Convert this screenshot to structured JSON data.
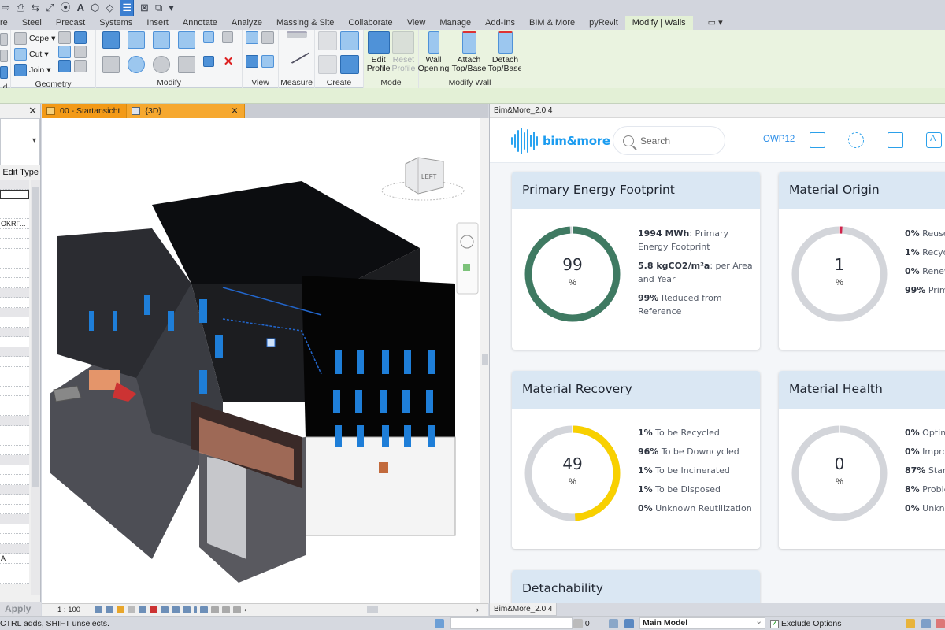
{
  "qat": {
    "items": [
      "arrow-redo",
      "printer",
      "measure",
      "dimension",
      "tag",
      "text",
      "3d-view",
      "section",
      "thin-lines",
      "close-hidden",
      "switch-windows",
      "customize"
    ]
  },
  "ribbon_tabs": [
    {
      "label": "re"
    },
    {
      "label": "Steel"
    },
    {
      "label": "Precast"
    },
    {
      "label": "Systems"
    },
    {
      "label": "Insert"
    },
    {
      "label": "Annotate"
    },
    {
      "label": "Analyze"
    },
    {
      "label": "Massing & Site"
    },
    {
      "label": "Collaborate"
    },
    {
      "label": "View"
    },
    {
      "label": "Manage"
    },
    {
      "label": "Add-Ins"
    },
    {
      "label": "BIM & More"
    },
    {
      "label": "pyRevit"
    },
    {
      "label": "Modify | Walls"
    }
  ],
  "ribbon": {
    "clipboard_title": "d",
    "geometry": {
      "title": "Geometry",
      "cope": "Cope",
      "cut": "Cut",
      "join": "Join"
    },
    "modify": {
      "title": "Modify"
    },
    "view": {
      "title": "View"
    },
    "measure": {
      "title": "Measure"
    },
    "create": {
      "title": "Create"
    },
    "mode": {
      "title": "Mode",
      "edit_profile": "Edit Profile",
      "reset_profile": "Reset Profile"
    },
    "modify_wall": {
      "title": "Modify Wall",
      "wall_opening": "Wall Opening",
      "attach": "Attach Top/Base",
      "detach": "Detach Top/Base"
    }
  },
  "properties": {
    "edit_type": "Edit Type",
    "apply": "Apply",
    "value_1": "OKRF...",
    "value_2": "A"
  },
  "view_tabs": [
    {
      "label": "00 - Startansicht"
    },
    {
      "label": "{3D}"
    }
  ],
  "viewcube": {
    "face": "LEFT"
  },
  "view_bar": {
    "scale": "1 : 100"
  },
  "bim_window": {
    "title": "Bim&More_2.0.4",
    "logo": "bim&more",
    "search_placeholder": "Search",
    "project": "OWP12",
    "colors": {
      "accent": "#1b9cf0",
      "header_bg": "#dae7f3",
      "green": "#3f7a62",
      "yellow": "#f8d000",
      "track": "#d3d5da",
      "red": "#d0234a"
    }
  },
  "cards": [
    {
      "title": "Primary Energy Footprint",
      "value": "99",
      "unit": "%",
      "percent": 99,
      "color": "#3f7a62",
      "legend": [
        {
          "bold": "1994 MWh",
          "text": ": Primary Energy Footprint"
        },
        {
          "bold": "5.8 kgCO2/m²a",
          "text": ": per Area and Year"
        },
        {
          "bold": "99%",
          "text": " Reduced from Reference"
        }
      ]
    },
    {
      "title": "Material Origin",
      "value": "1",
      "unit": "%",
      "percent": 1,
      "color": "#d0234a",
      "legend": [
        {
          "bold": "0%",
          "text": " Reuse"
        },
        {
          "bold": "1%",
          "text": " Recycl"
        },
        {
          "bold": "0%",
          "text": " Renew Materials"
        },
        {
          "bold": "99%",
          "text": " Prim"
        }
      ]
    },
    {
      "title": "Material Recovery",
      "value": "49",
      "unit": "%",
      "percent": 49,
      "color": "#f8d000",
      "legend": [
        {
          "bold": "1%",
          "text": " To be Recycled"
        },
        {
          "bold": "96%",
          "text": " To be Downcycled"
        },
        {
          "bold": "1%",
          "text": " To be Incinerated"
        },
        {
          "bold": "1%",
          "text": " To be Disposed"
        },
        {
          "bold": "0%",
          "text": " Unknown Reutilization"
        }
      ]
    },
    {
      "title": "Material Health",
      "value": "0",
      "unit": "%",
      "percent": 0,
      "color": "#3f7a62",
      "legend": [
        {
          "bold": "0%",
          "text": " Optim"
        },
        {
          "bold": "0%",
          "text": " Impro"
        },
        {
          "bold": "87%",
          "text": " Stan"
        },
        {
          "bold": "8%",
          "text": " Proble"
        },
        {
          "bold": "0%",
          "text": " Unkno"
        }
      ]
    },
    {
      "title": "Detachability"
    }
  ],
  "bottom_tab": "Bim&More_2.0.4",
  "status": {
    "message": "CTRL adds, SHIFT unselects.",
    "count": ":0",
    "model": "Main Model",
    "exclude_options": "Exclude Options"
  }
}
